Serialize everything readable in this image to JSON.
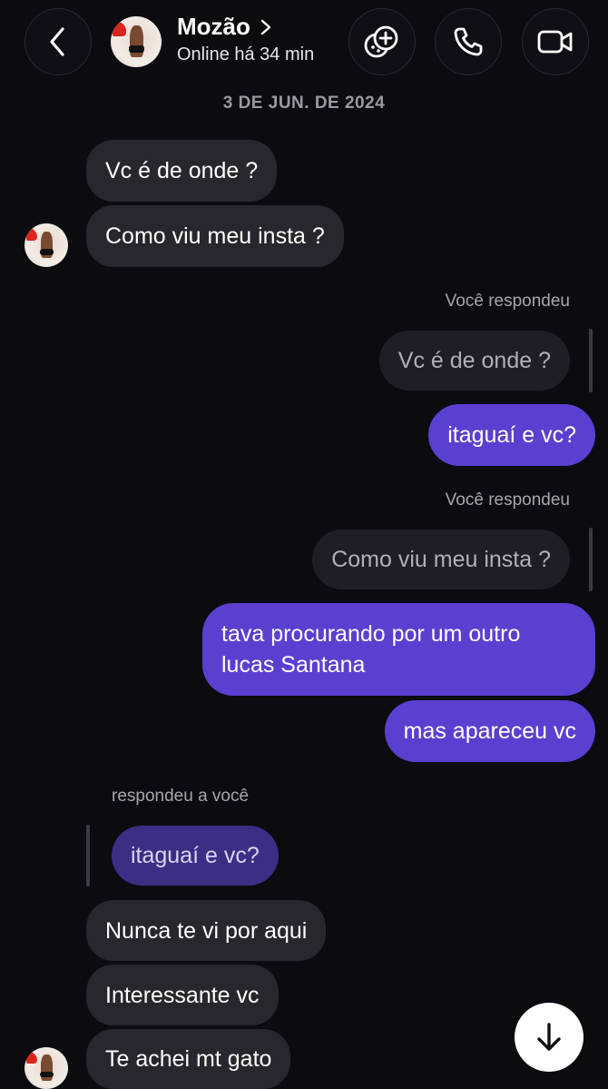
{
  "header": {
    "contact_name": "Mozão",
    "status": "Online há 34 min",
    "icons": {
      "back": "chevron-left-icon",
      "name_chevron": "chevron-right-icon",
      "effects": "sticker-effects-icon",
      "call": "phone-icon",
      "video": "video-camera-icon"
    }
  },
  "date_separator": "3 DE JUN. DE 2024",
  "messages": {
    "m1": "Vc é de onde ?",
    "m2": "Como viu meu insta ?",
    "reply1_label": "Você respondeu",
    "reply1_quote": "Vc é de onde ?",
    "m3": "itaguaí e vc?",
    "reply2_label": "Você respondeu",
    "reply2_quote": "Como viu meu insta ?",
    "m4": "tava procurando por um outro lucas Santana",
    "m5": "mas apareceu vc",
    "reply3_label": "respondeu a você",
    "reply3_quote": "itaguaí e vc?",
    "m6": "Nunca te vi por aqui",
    "m7": "Interessante vc",
    "m8": "Te achei mt gato"
  },
  "colors": {
    "background": "#0b0b10",
    "incoming_bubble": "#27272d",
    "outgoing_bubble": "#5b3fd0",
    "quoted_purple": "#3b2e84"
  },
  "scroll_button_icon": "arrow-down-icon"
}
